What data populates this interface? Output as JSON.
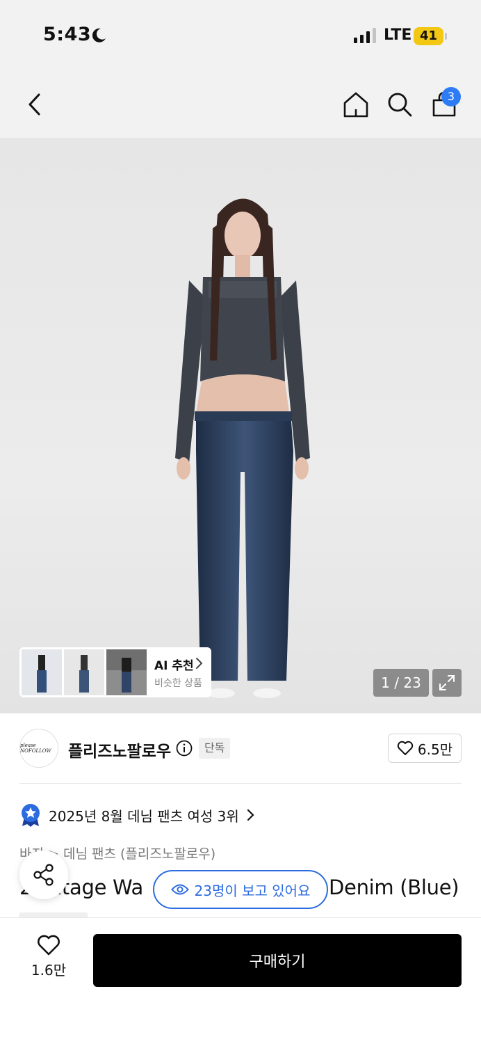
{
  "status_bar": {
    "time": "5:43",
    "network": "LTE",
    "battery": "41",
    "battery_color": "#f2c814"
  },
  "nav": {
    "icons": [
      "back-icon",
      "home-icon",
      "search-icon",
      "cart-icon"
    ],
    "cart_count": "3",
    "badge_color": "#2d7cf6"
  },
  "gallery": {
    "counter": "1 / 23",
    "ai_reco_title": "AI 추천",
    "ai_reco_subtitle": "비슷한 상품"
  },
  "brand": {
    "logo_text": "please NOFOLLOW",
    "name": "플리즈노팔로우",
    "exclusive_label": "단독",
    "like_count": "6.5만"
  },
  "ranking": {
    "text": "2025년 8월 데님 팬츠 여성 3위"
  },
  "breadcrumb": {
    "category": "바지",
    "subcategory": "데님 팬츠 (플리즈노팔로우)"
  },
  "product": {
    "title_start": "2",
    "title_mid": "intage Wa",
    "title_end": "Denim (Blue)"
  },
  "viewers": {
    "text": "23명이 보고 있어요",
    "accent_color": "#2d6cdf"
  },
  "bottom_bar": {
    "wish_count": "1.6만",
    "buy_label": "구매하기"
  }
}
